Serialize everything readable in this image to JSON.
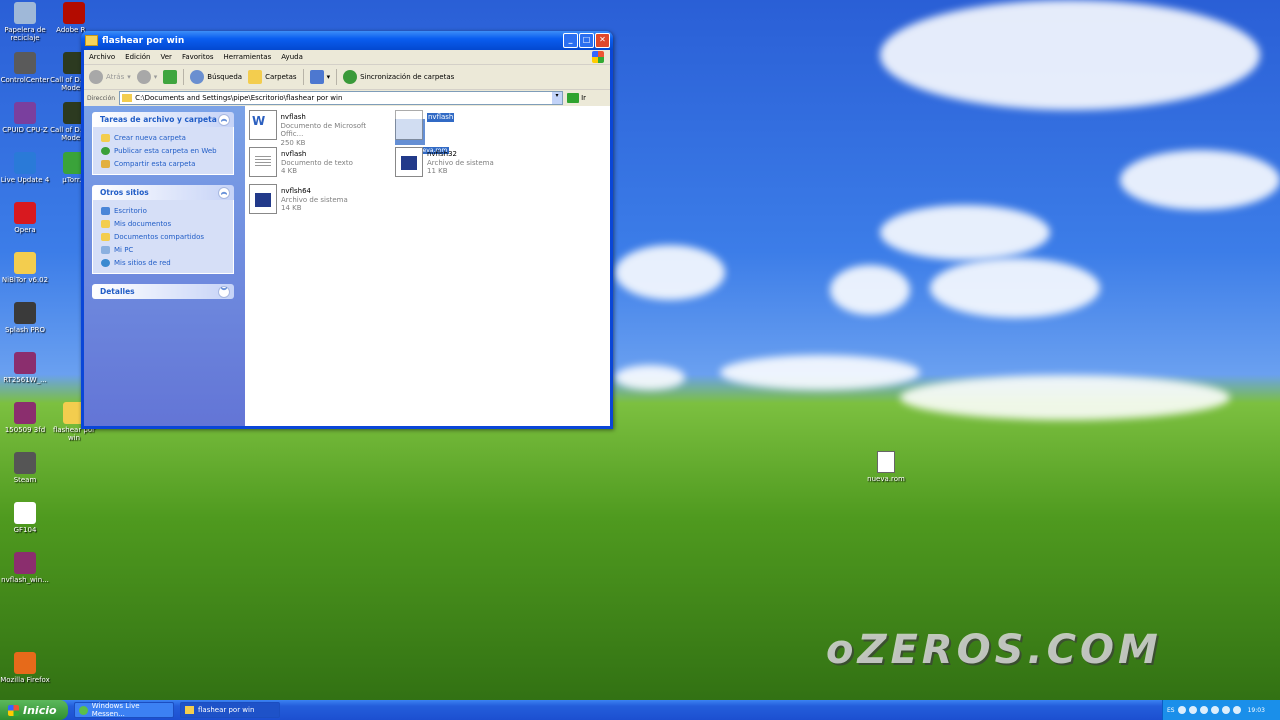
{
  "desktop_icons_left": [
    {
      "label": "Papelera de reciclaje",
      "color": "#9fb8d8"
    },
    {
      "label": "ControlCenter",
      "color": "#5a5a5a"
    },
    {
      "label": "CPUID CPU-Z",
      "color": "#7a3f9e"
    },
    {
      "label": "Live Update 4",
      "color": "#2a7ad8"
    },
    {
      "label": "Opera",
      "color": "#d8191f"
    },
    {
      "label": "NiBiTor v6.02",
      "color": "#f3cd4e"
    },
    {
      "label": "Splash PRO",
      "color": "#3a3a3a"
    },
    {
      "label": "RT2561W_...",
      "color": "#8b2e6e"
    },
    {
      "label": "150509 3fd",
      "color": "#8b2e6e"
    },
    {
      "label": "Steam",
      "color": "#555555"
    },
    {
      "label": "GF104",
      "color": "#ffffff"
    },
    {
      "label": "nvflash_win...",
      "color": "#8b2e6e"
    },
    {
      "label": "Mozilla Firefox",
      "color": "#e66a1a"
    }
  ],
  "desktop_icons_col2": [
    {
      "label": "Adobe R...",
      "color": "#b30b00"
    },
    {
      "label": "Call of D... 4 - Mode...",
      "color": "#2c3a20"
    },
    {
      "label": "Call of D... 4 - Mode...",
      "color": "#2c3a20"
    },
    {
      "label": "µTorr...",
      "color": "#3aa33a"
    },
    {
      "label": "flashear por win",
      "color": "#f3cd4e"
    }
  ],
  "desktop_file": {
    "label": "nueva.rom"
  },
  "watermark": "oZEROS.COM",
  "window": {
    "title": "flashear por win",
    "menu": [
      "Archivo",
      "Edición",
      "Ver",
      "Favoritos",
      "Herramientas",
      "Ayuda"
    ],
    "toolbar": {
      "back": "Atrás",
      "search": "Búsqueda",
      "folders": "Carpetas",
      "sync": "Sincronización de carpetas"
    },
    "address_label": "Dirección",
    "address_value": "C:\\Documents and Settings\\pipe\\Escritorio\\flashear por win",
    "go_label": "Ir"
  },
  "panels": [
    {
      "title": "Tareas de archivo y carpeta",
      "links": [
        "Crear nueva carpeta",
        "Publicar esta carpeta en Web",
        "Compartir esta carpeta"
      ]
    },
    {
      "title": "Otros sitios",
      "links": [
        "Escritorio",
        "Mis documentos",
        "Documentos compartidos",
        "Mi PC",
        "Mis sitios de red"
      ]
    },
    {
      "title": "Detalles",
      "links": []
    }
  ],
  "files": [
    {
      "name": "nvflash",
      "type": "Documento de Microsoft Offic...",
      "size": "250 KB"
    },
    {
      "name": "nvflash",
      "type": "Documento de texto",
      "size": "4 KB"
    },
    {
      "name": "nvflsh64",
      "type": "Archivo de sistema",
      "size": "14 KB"
    },
    {
      "name": "nvflash",
      "type": "",
      "size": ""
    },
    {
      "name": "nvflsh32",
      "type": "Archivo de sistema",
      "size": "11 KB"
    }
  ],
  "drag_label": "nueva.rom",
  "taskbar": {
    "start": "Inicio",
    "tasks": [
      "Windows Live Messen...",
      "flashear por win"
    ],
    "lang": "ES",
    "clock": "19:03"
  }
}
